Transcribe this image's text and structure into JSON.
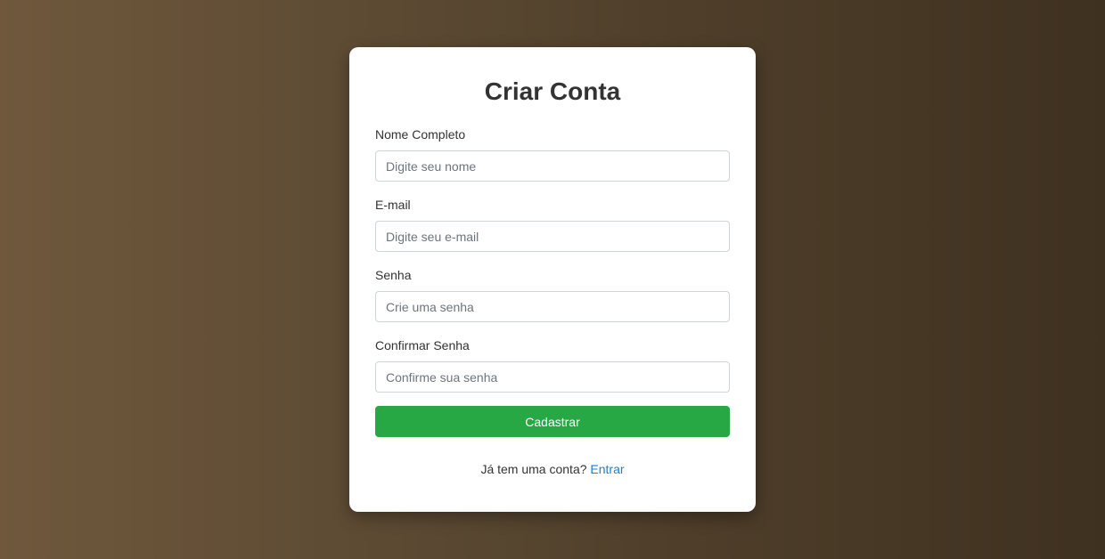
{
  "form": {
    "title": "Criar Conta",
    "fields": [
      {
        "label": "Nome Completo",
        "placeholder": "Digite seu nome",
        "value": ""
      },
      {
        "label": "E-mail",
        "placeholder": "Digite seu e-mail",
        "value": ""
      },
      {
        "label": "Senha",
        "placeholder": "Crie uma senha",
        "value": ""
      },
      {
        "label": "Confirmar Senha",
        "placeholder": "Confirme sua senha",
        "value": ""
      }
    ],
    "submit_label": "Cadastrar",
    "footer_text": "Já tem uma conta?",
    "footer_link": "Entrar"
  },
  "colors": {
    "primary_button": "#28a745",
    "link": "#1a7fd6",
    "background_start": "#6f583c",
    "background_end": "#3f3120"
  }
}
